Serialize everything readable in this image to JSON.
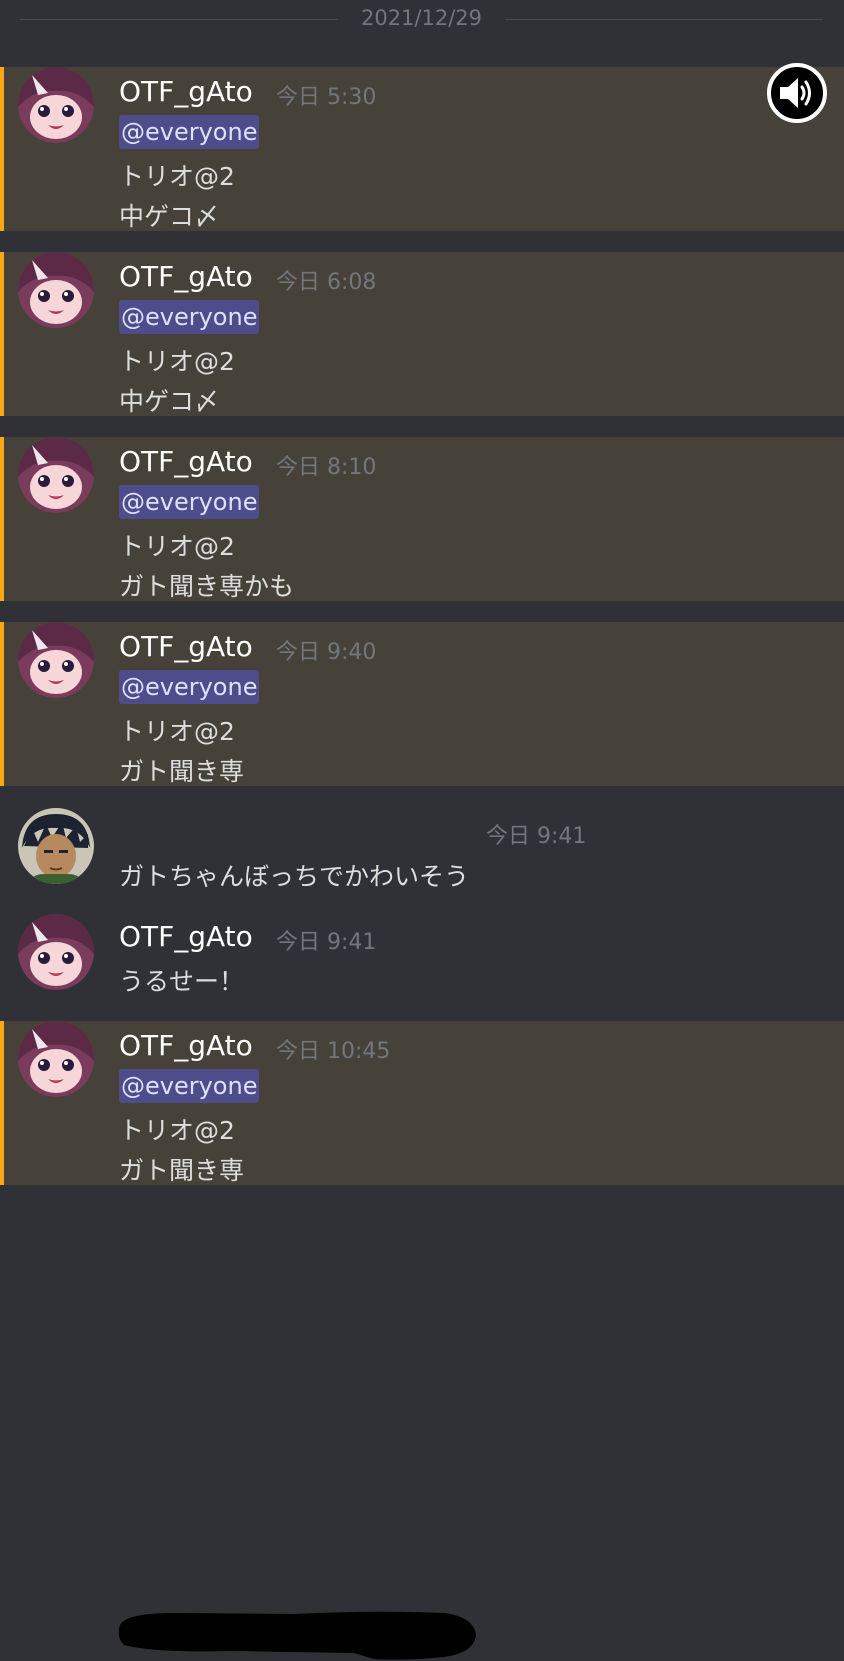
{
  "date_divider": "2021/12/29",
  "messages": [
    {
      "user": "OTF_gAto",
      "time": "今日 5:30",
      "mention": "@everyone",
      "lines": [
        "トリオ@2",
        "中ゲコ〆"
      ]
    },
    {
      "user": "OTF_gAto",
      "time": "今日 6:08",
      "mention": "@everyone",
      "lines": [
        "トリオ@2",
        "中ゲコ〆"
      ]
    },
    {
      "user": "OTF_gAto",
      "time": "今日 8:10",
      "mention": "@everyone",
      "lines": [
        "トリオ@2",
        "ガト聞き専かも"
      ]
    },
    {
      "user": "OTF_gAto",
      "time": "今日 9:40",
      "mention": "@everyone",
      "lines": [
        "トリオ@2",
        "ガト聞き専"
      ]
    },
    {
      "user": "",
      "time": "今日 9:41",
      "lines": [
        "ガトちゃんぼっちでかわいそう"
      ]
    },
    {
      "user": "OTF_gAto",
      "time": "今日 9:41",
      "lines": [
        "うるせー！"
      ]
    },
    {
      "user": "OTF_gAto",
      "time": "今日 10:45",
      "mention": "@everyone",
      "lines": [
        "トリオ@2",
        "ガト聞き専"
      ]
    }
  ],
  "icons": {
    "audio": "speaker-icon",
    "avatar_a": "anime-girl-avatar",
    "avatar_b": "anime-man-avatar"
  },
  "colors": {
    "background": "#2f3136",
    "mention_bg": "#474239",
    "mention_bar": "#faa81a",
    "ping_bg": "#4c4d8a"
  }
}
